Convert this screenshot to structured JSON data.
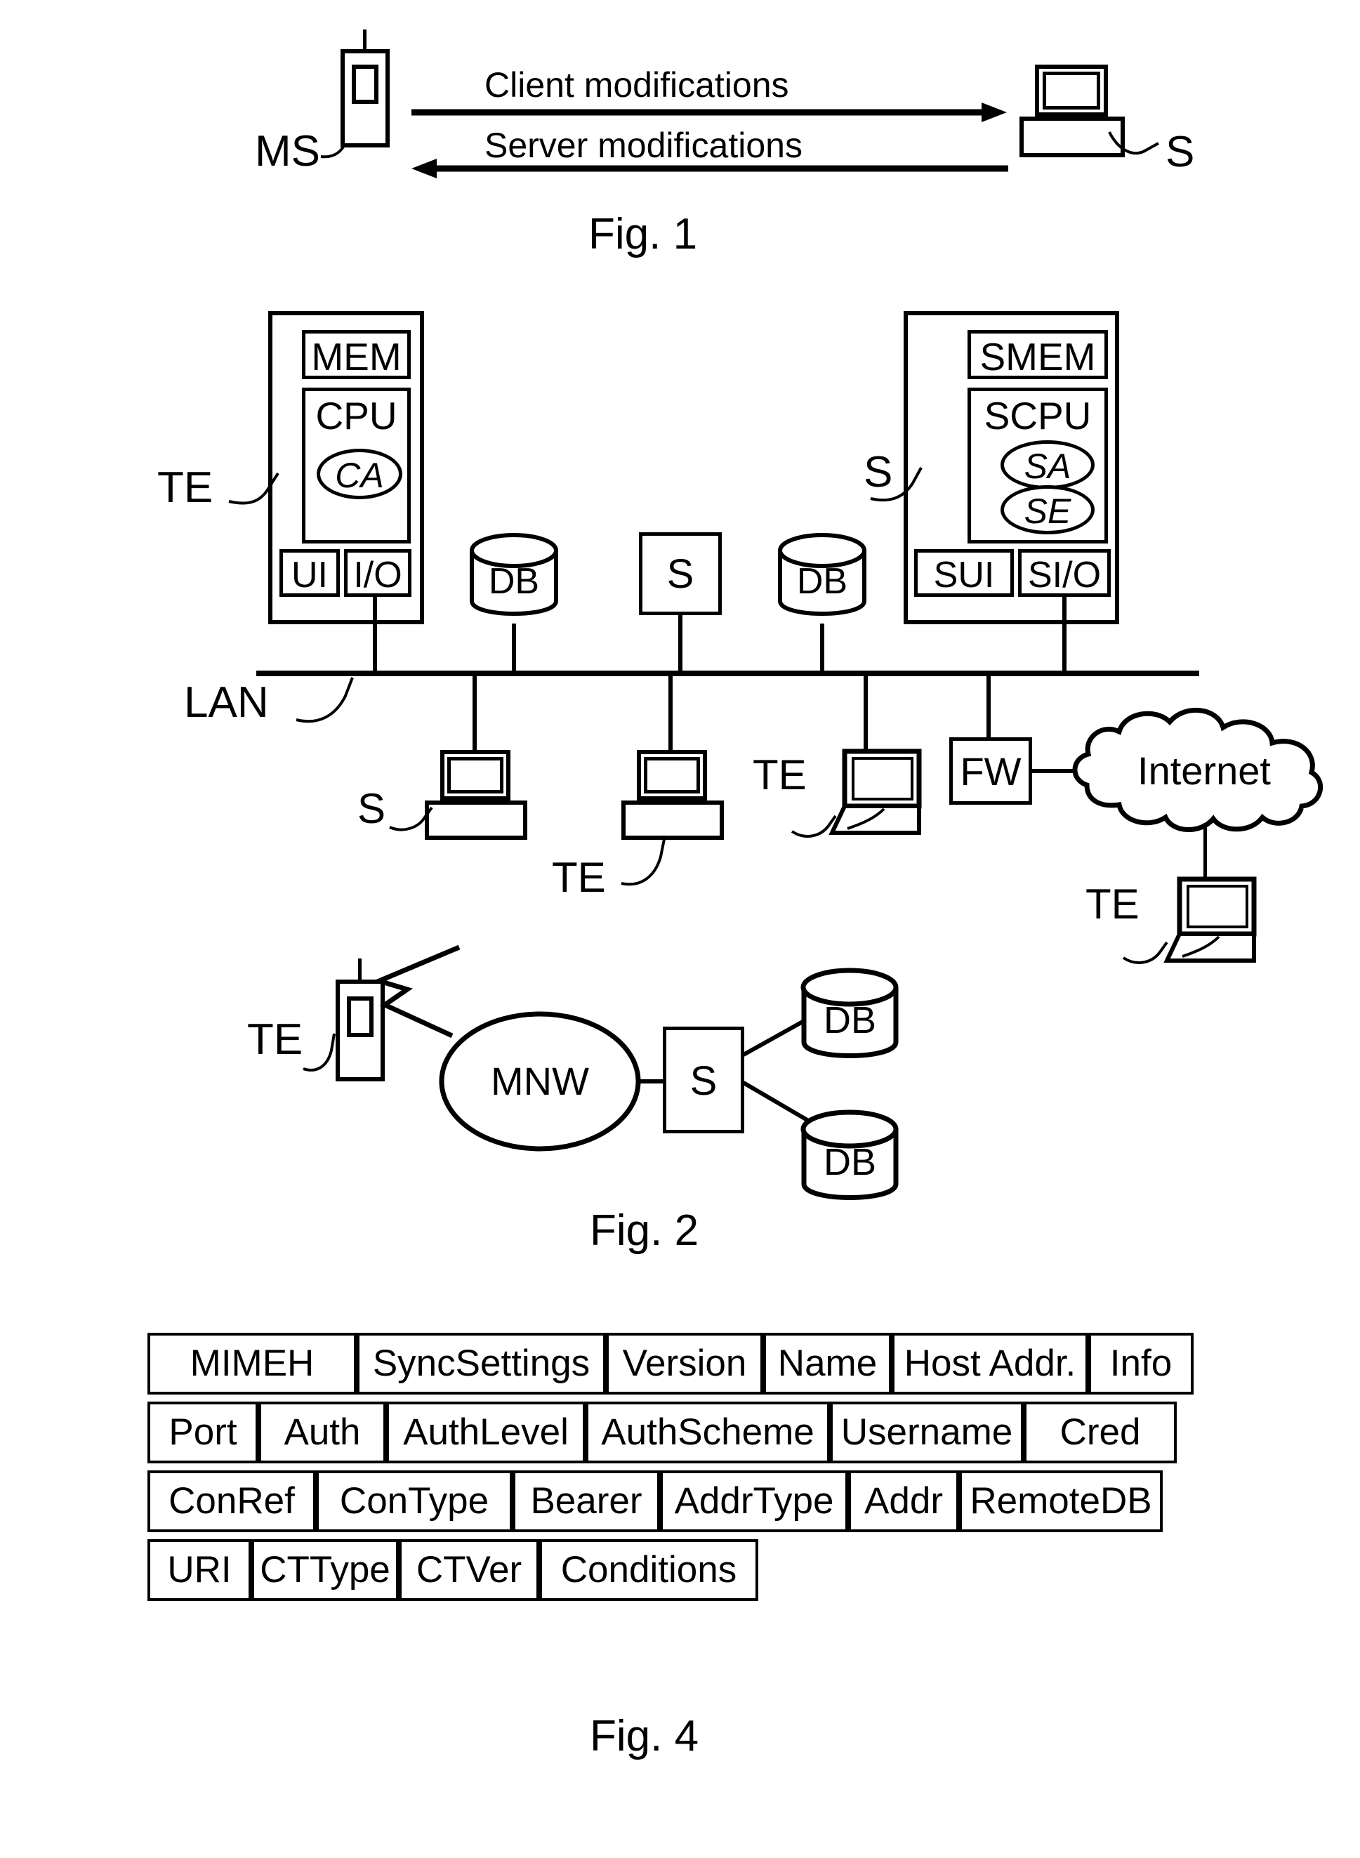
{
  "figures": [
    {
      "id": "fig1",
      "caption": "Fig. 1"
    },
    {
      "id": "fig2",
      "caption": "Fig. 2"
    },
    {
      "id": "fig4",
      "caption": "Fig. 4"
    }
  ],
  "fig1": {
    "caption": "Fig. 1",
    "client_label": "MS",
    "server_label": "S",
    "arrow_top_label": "Client modifications",
    "arrow_bottom_label": "Server modifications"
  },
  "fig2": {
    "caption": "Fig. 2",
    "terminal": {
      "ref_label": "TE",
      "memory": "MEM",
      "cpu": "CPU",
      "agent": "CA",
      "ui": "UI",
      "io": "I/O"
    },
    "server": {
      "ref_label": "S",
      "memory": "SMEM",
      "cpu": "SCPU",
      "agent": "SA",
      "engine": "SE",
      "ui": "SUI",
      "io": "SI/O"
    },
    "bus_label": "LAN",
    "lan_nodes": [
      {
        "name": "db-left",
        "label": "DB"
      },
      {
        "name": "server-box",
        "label": "S"
      },
      {
        "name": "db-right",
        "label": "DB"
      }
    ],
    "below_bus": [
      {
        "name": "desktop-server",
        "label": "S"
      },
      {
        "name": "desktop-terminal",
        "label": "TE"
      },
      {
        "name": "laptop-terminal",
        "label": "TE"
      }
    ],
    "firewall_label": "FW",
    "internet_label": "Internet",
    "internet_terminal_label": "TE",
    "mobile": {
      "terminal_label": "TE",
      "network_label": "MNW",
      "server_label": "S",
      "db_top_label": "DB",
      "db_bottom_label": "DB"
    }
  },
  "fig4": {
    "caption": "Fig. 4",
    "rows": [
      {
        "cells": [
          "MIMEH",
          "SyncSettings",
          "Version",
          "Name",
          "Host Addr.",
          "Info"
        ]
      },
      {
        "cells": [
          "Port",
          "Auth",
          "AuthLevel",
          "AuthScheme",
          "Username",
          "Cred"
        ]
      },
      {
        "cells": [
          "ConRef",
          "ConType",
          "Bearer",
          "AddrType",
          "Addr",
          "RemoteDB"
        ]
      },
      {
        "cells": [
          "URI",
          "CTType",
          "CTVer",
          "Conditions"
        ]
      }
    ]
  },
  "colors": {
    "ink": "#000000",
    "paper": "#ffffff"
  }
}
